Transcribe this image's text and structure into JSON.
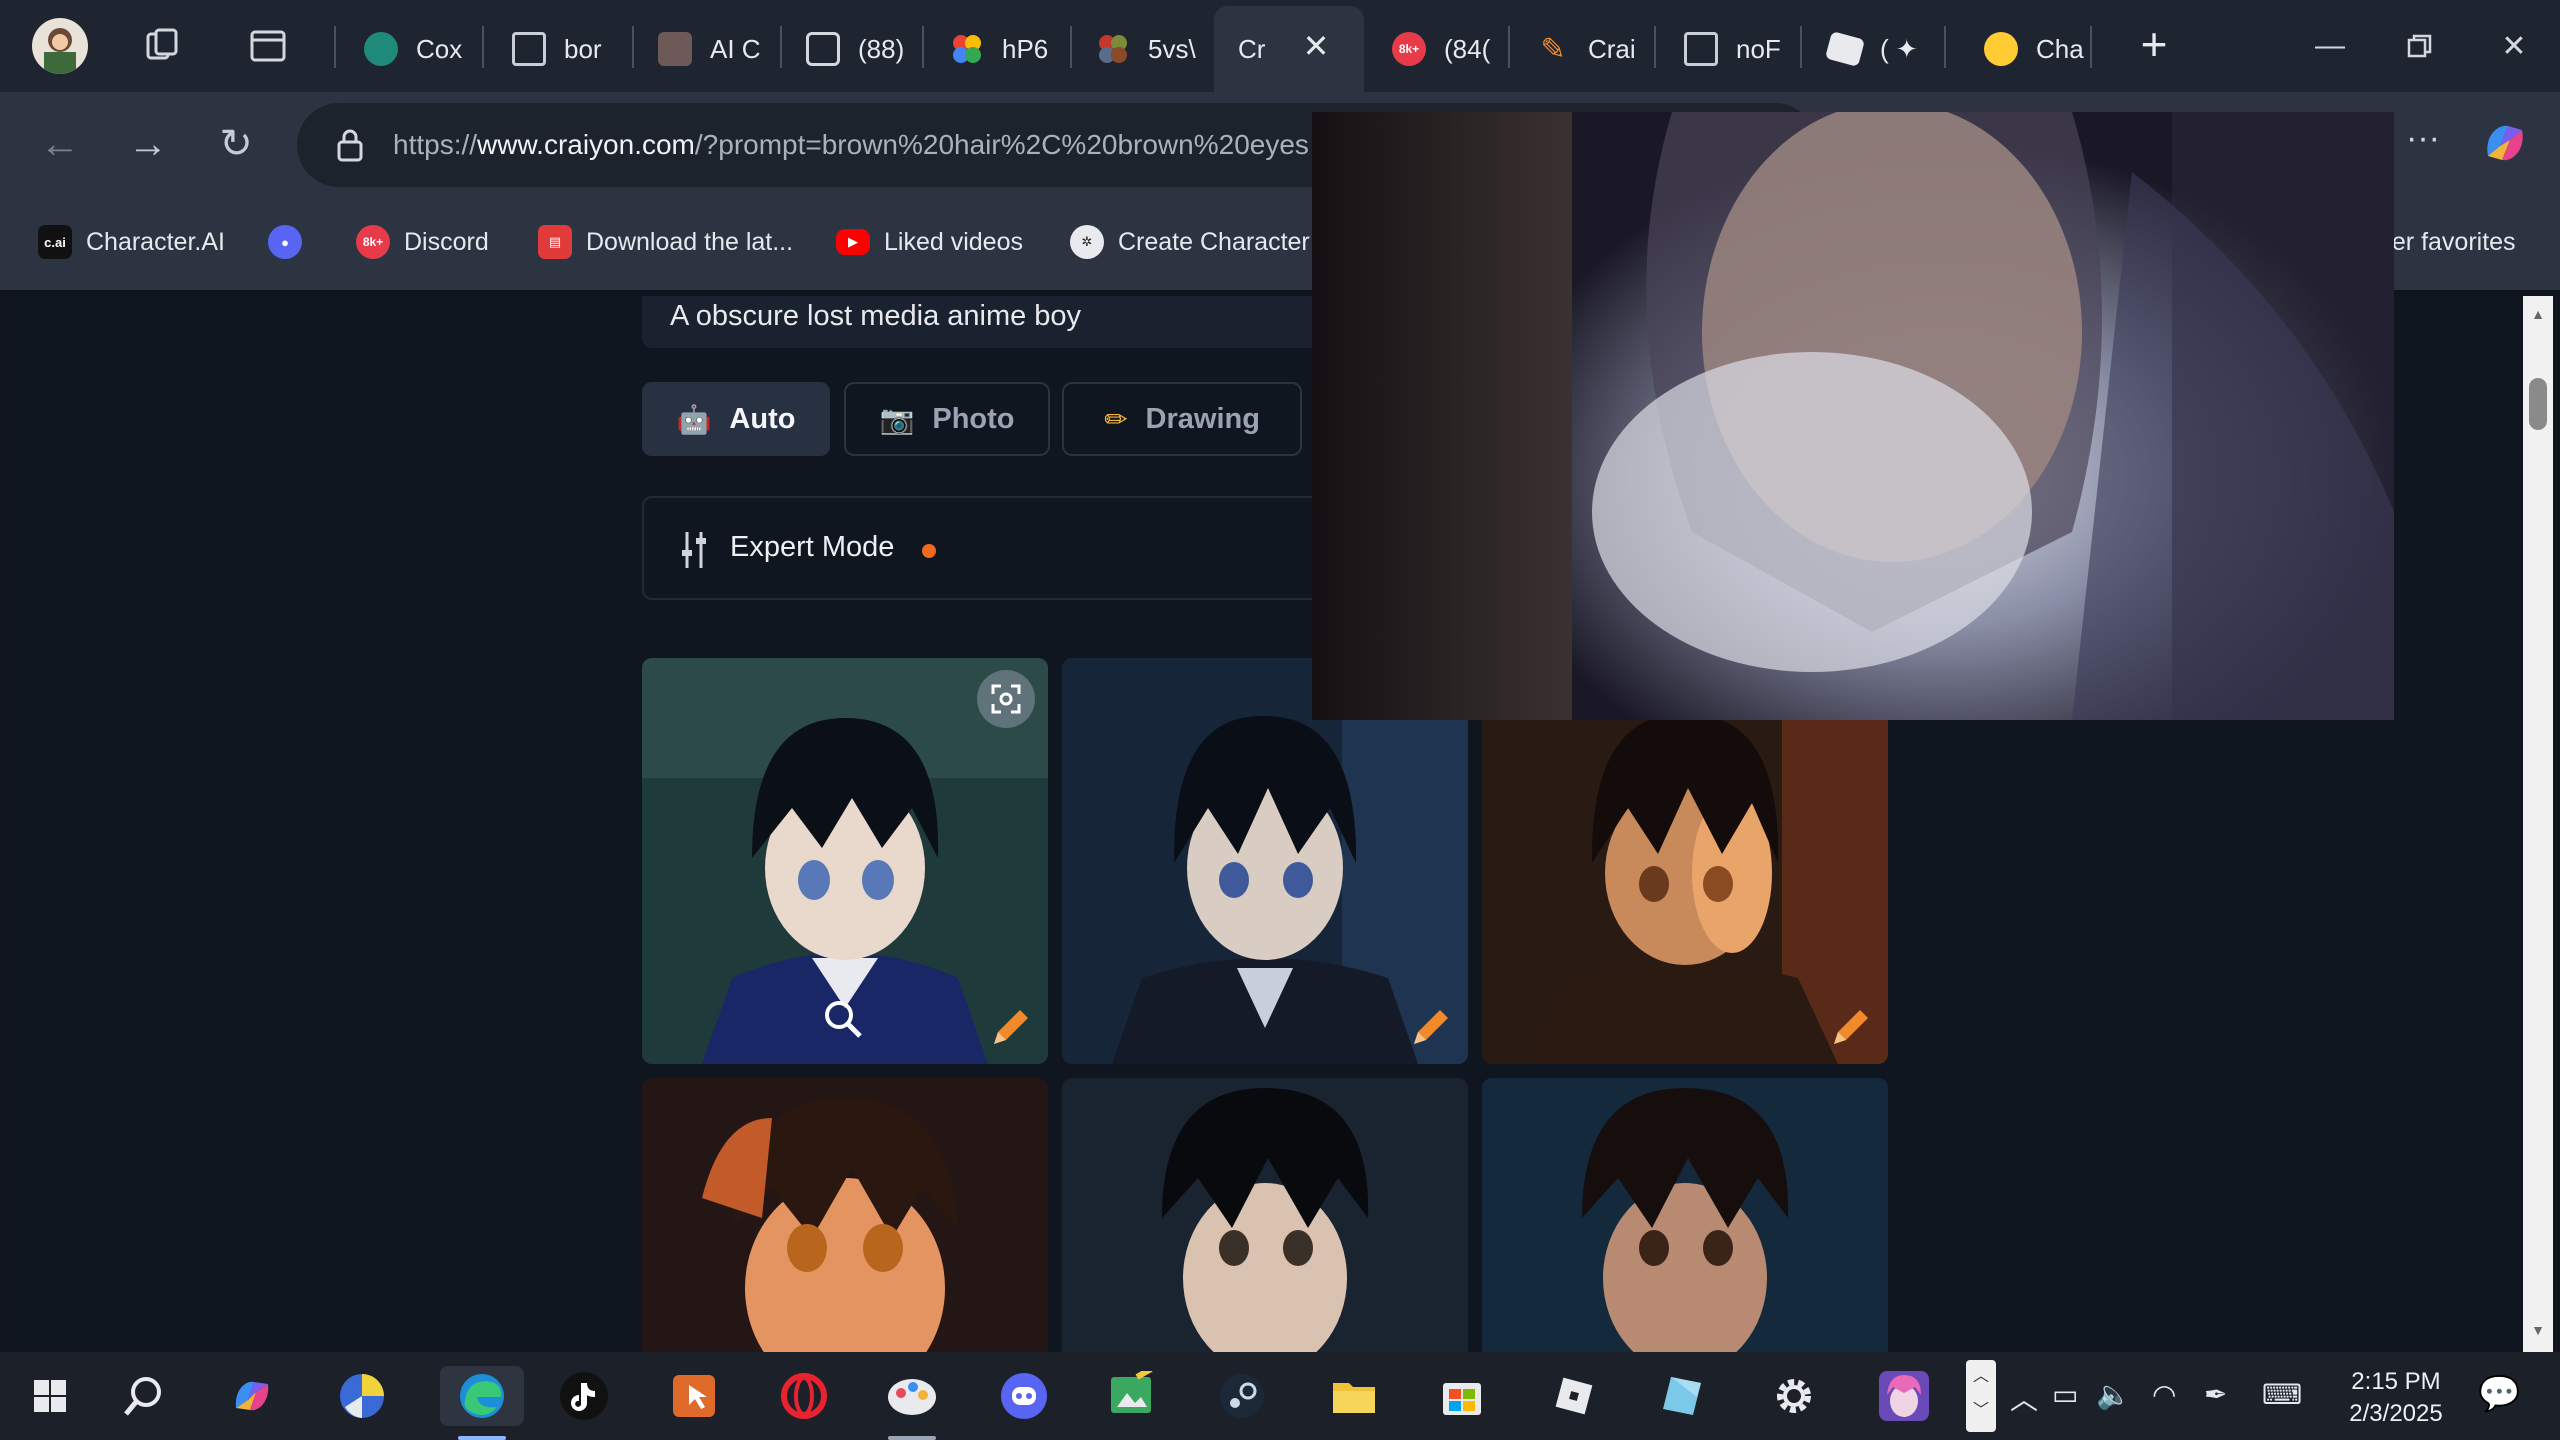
{
  "tabs": [
    {
      "title": "Cox"
    },
    {
      "title": "bor"
    },
    {
      "title": "AI C"
    },
    {
      "title": "(88)"
    },
    {
      "title": "hP6"
    },
    {
      "title": "5vs\\"
    },
    {
      "title": "Cr",
      "active": true
    },
    {
      "title": "(84("
    },
    {
      "title": "Crai"
    },
    {
      "title": "noF"
    },
    {
      "title": "( ✦"
    },
    {
      "title": "Cha"
    }
  ],
  "address_bar": {
    "url_prefix": "https://",
    "url_domain": "www.craiyon.com",
    "url_path": "/?prompt=brown%20hair%2C%20brown%20eyes"
  },
  "favorites": [
    {
      "label": "Character.AI",
      "icon": "c.ai"
    },
    {
      "label": "",
      "icon": "discord-icon"
    },
    {
      "label": "Discord",
      "icon": "8k+"
    },
    {
      "label": "Download the lat...",
      "icon": "store-icon"
    },
    {
      "label": "Liked videos",
      "icon": "youtube-icon"
    },
    {
      "label": "Create Character",
      "icon": "openai-icon"
    },
    {
      "label": "ner favorites",
      "icon": ""
    }
  ],
  "page": {
    "prompt_text": "A obscure lost media anime boy",
    "modes": [
      {
        "label": "Auto",
        "selected": true
      },
      {
        "label": "Photo",
        "selected": false
      },
      {
        "label": "Drawing",
        "selected": false
      }
    ],
    "expert_mode_label": "Expert Mode"
  },
  "images": [
    {
      "subject": "anime-boy-blue-eyes-jacket"
    },
    {
      "subject": "anime-boy-dark-blue-suit"
    },
    {
      "subject": "anime-boy-brown-eyes-warm"
    },
    {
      "subject": "anime-boy-orange-lit"
    },
    {
      "subject": "anime-boy-dark-hair"
    },
    {
      "subject": "anime-boy-night"
    }
  ],
  "clock": {
    "time": "2:15 PM",
    "date": "2/3/2025"
  },
  "colors": {
    "accent_orange": "#ef6a1f",
    "page_bg": "#101620",
    "chrome_bg": "#2c3442"
  }
}
